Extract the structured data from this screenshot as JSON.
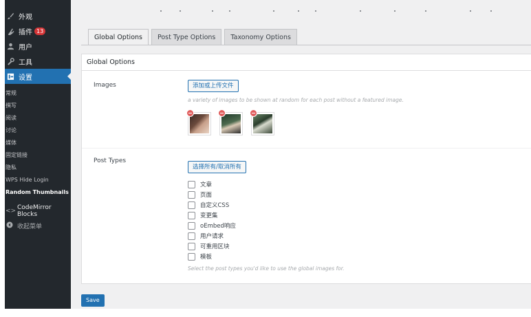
{
  "sidebar": {
    "items": [
      {
        "label": "外观",
        "icon": "paint-brush-icon"
      },
      {
        "label": "插件",
        "icon": "plugin-icon",
        "badge": "13"
      },
      {
        "label": "用户",
        "icon": "user-icon"
      },
      {
        "label": "工具",
        "icon": "wrench-icon"
      },
      {
        "label": "设置",
        "icon": "settings-icon"
      }
    ],
    "submenu": [
      "常规",
      "撰写",
      "阅读",
      "讨论",
      "媒体",
      "固定链接",
      "隐私",
      "WPS Hide Login",
      "Random Thumbnails"
    ],
    "extra": [
      {
        "label": "CodeMirror Blocks",
        "icon": "code-icon"
      },
      {
        "label": "收起菜单",
        "icon": "collapse-icon"
      }
    ]
  },
  "tabs": [
    "Global Options",
    "Post Type Options",
    "Taxonomy Options"
  ],
  "panel": {
    "title": "Global Options",
    "images": {
      "label": "Images",
      "button": "添加或上传文件",
      "description": "a variety of images to be shown at random for each post without a featured image."
    },
    "post_types": {
      "label": "Post Types",
      "button": "选择所有/取消所有",
      "options": [
        "文章",
        "页面",
        "自定义CSS",
        "变更集",
        "oEmbed响应",
        "用户请求",
        "可重用区块",
        "模板"
      ],
      "description": "Select the post types you'd like to use the global images for."
    }
  },
  "save_label": "Save",
  "colors": {
    "accent": "#2271b1",
    "sidebar": "#23282d",
    "badge": "#d63638"
  }
}
